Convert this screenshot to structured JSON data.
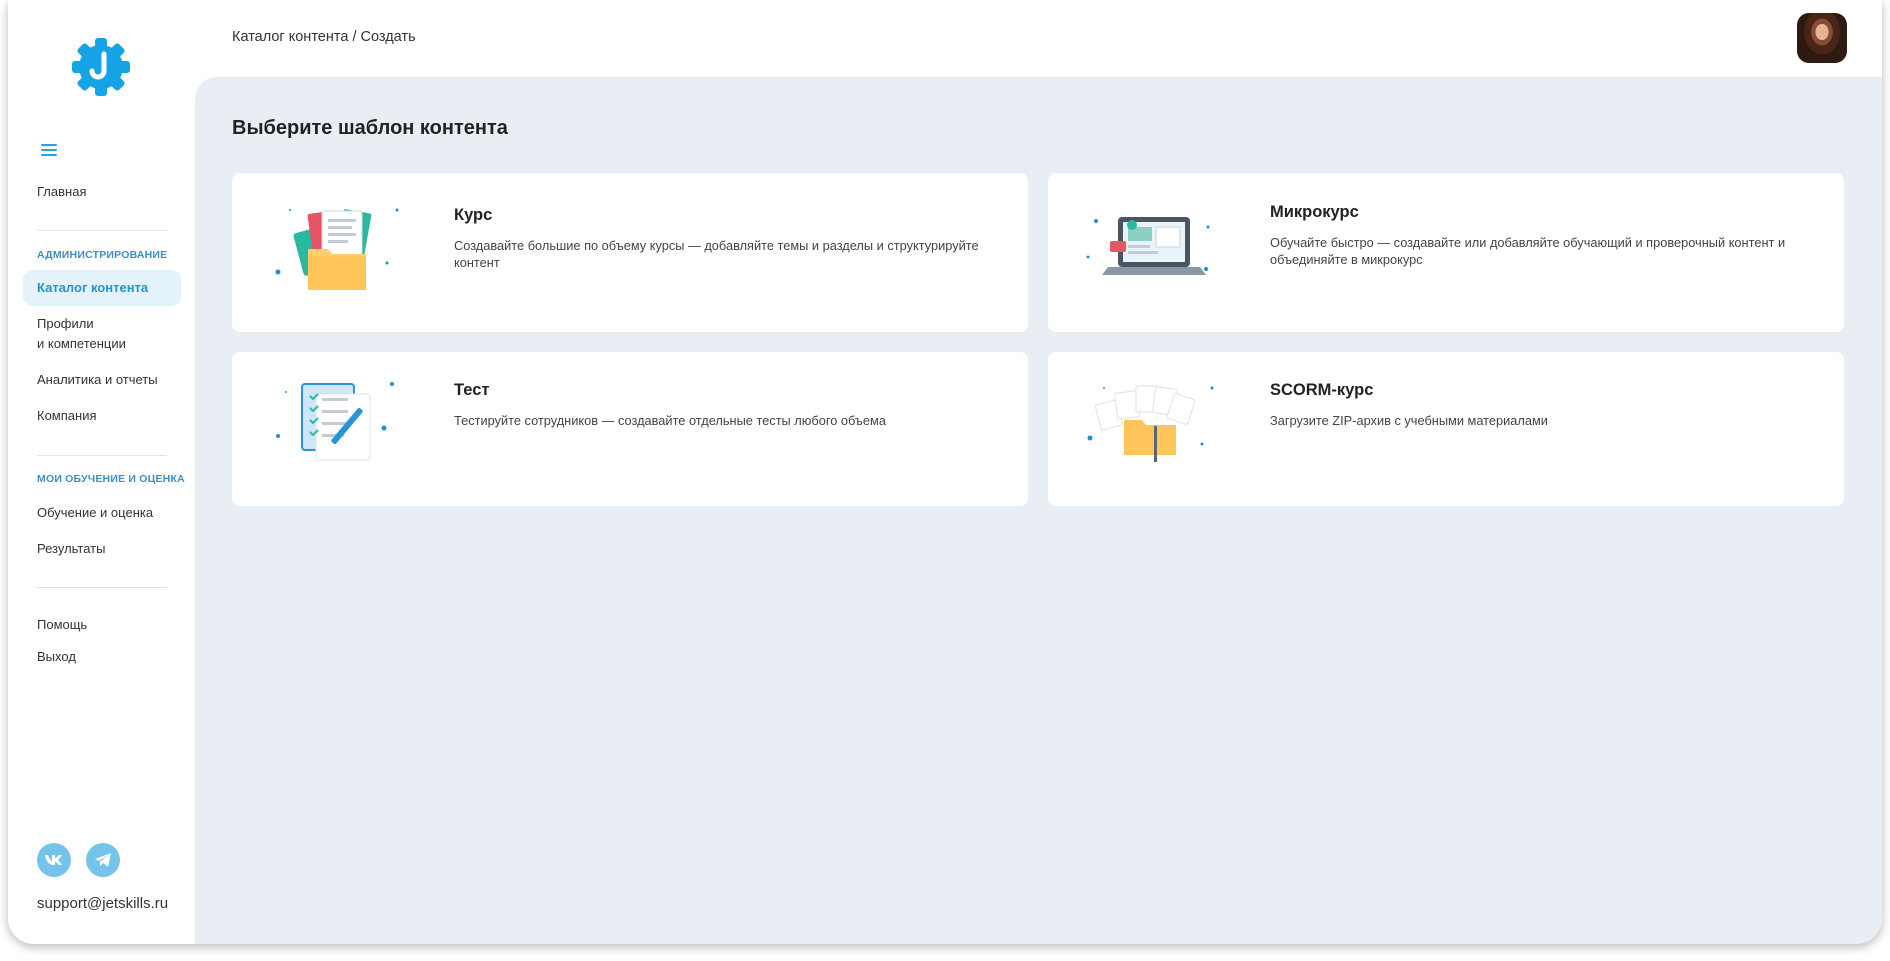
{
  "sidebar": {
    "menu_icon": "hamburger-menu-icon",
    "home": "Главная",
    "section_admin": "АДМИНИСТРИРОВАНИЕ",
    "catalog": "Каталог контента",
    "profiles_line1": "Профили",
    "profiles_line2": "и компетенции",
    "analytics": "Аналитика и отчеты",
    "company": "Компания",
    "section_learning": "МОИ ОБУЧЕНИЕ И ОЦЕНКА",
    "learning": "Обучение и оценка",
    "results": "Результаты",
    "help": "Помощь",
    "logout": "Выход",
    "support_email": "support@jetskills.ru"
  },
  "header": {
    "breadcrumb_root": "Каталог контента",
    "breadcrumb_sep": " / ",
    "breadcrumb_current": "Создать"
  },
  "main": {
    "title": "Выберите шаблон контента",
    "cards": [
      {
        "title": "Курс",
        "description": "Создавайте большие по объему курсы — добавляйте темы и разделы и структурируйте контент",
        "icon": "folder-documents-icon"
      },
      {
        "title": "Микрокурс",
        "description": "Обучайте быстро — создавайте или добавляйте обучающий и проверочный контент и объединяйте в микрокурс",
        "icon": "laptop-icon"
      },
      {
        "title": "Тест",
        "description": "Тестируйте сотрудников — создавайте отдельные тесты любого объема",
        "icon": "checklist-icon"
      },
      {
        "title": "SCORM-курс",
        "description": "Загрузите ZIP-архив с учебными материалами",
        "icon": "zip-folder-icon"
      }
    ]
  },
  "colors": {
    "accent": "#23a4e0",
    "background": "#e9eef5",
    "active_bg": "#e4f3fb"
  }
}
